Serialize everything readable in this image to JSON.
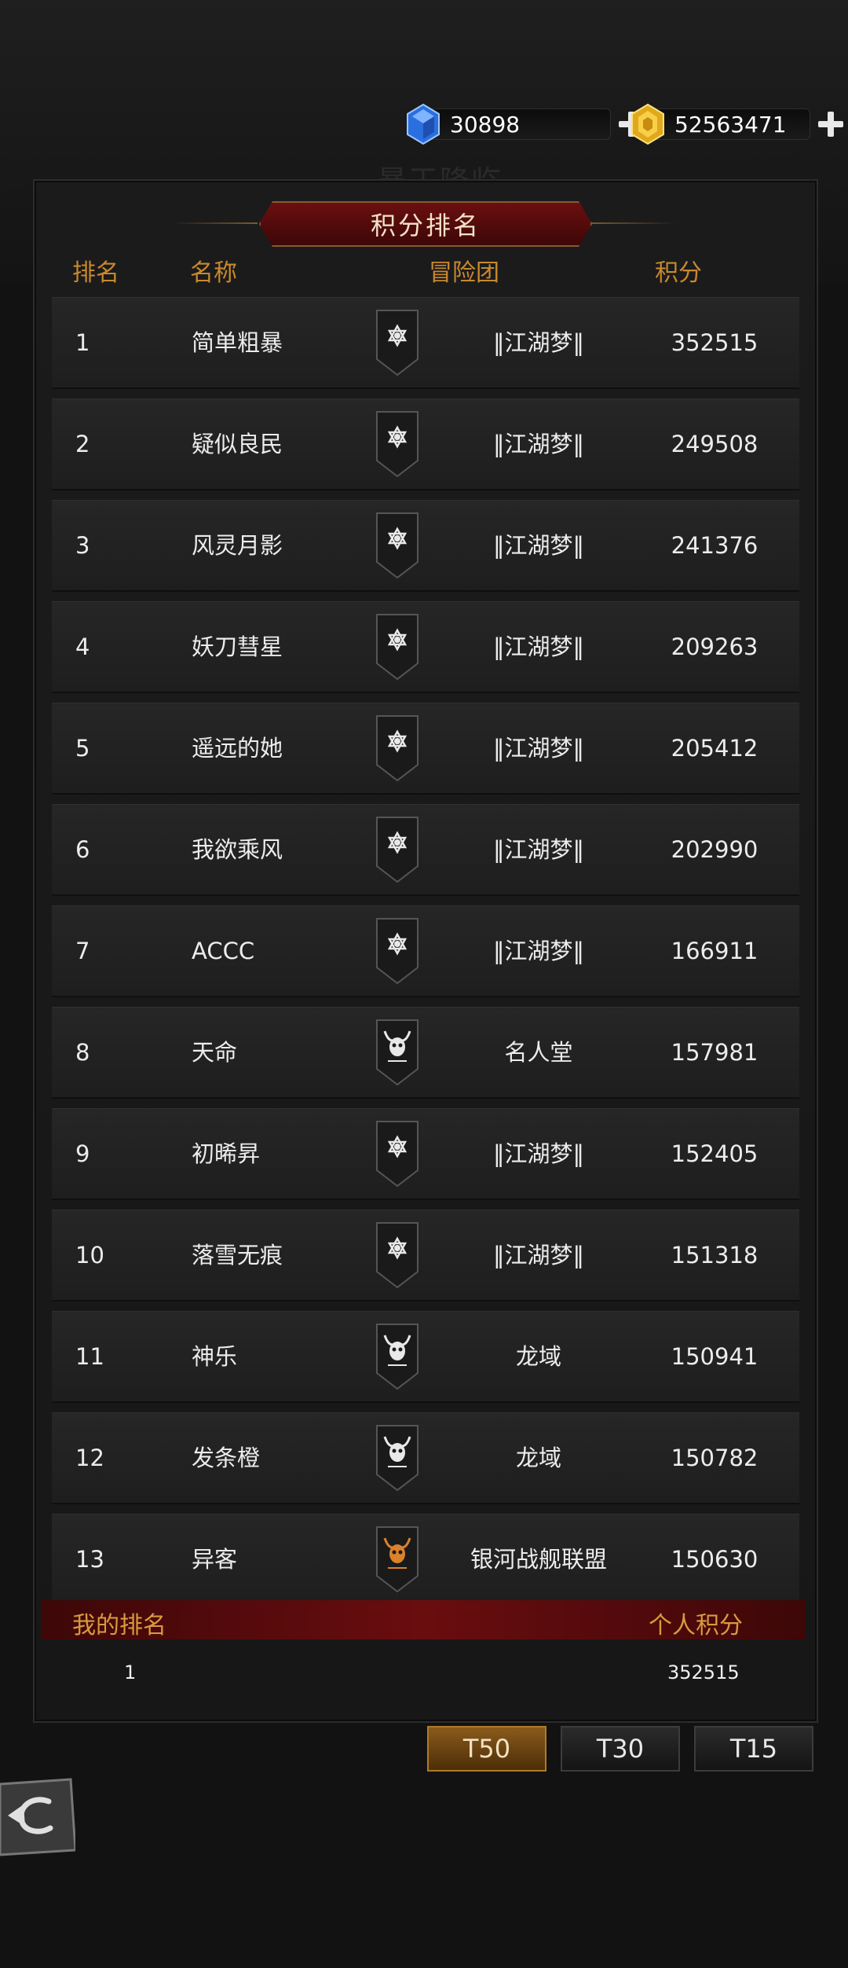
{
  "header": {
    "ghost_title": "暴王降临"
  },
  "currency": {
    "gems": "30898",
    "gold": "52563471"
  },
  "ranking": {
    "title": "积分排名",
    "col_rank": "排名",
    "col_name": "名称",
    "col_team": "冒险团",
    "col_score": "积分",
    "rows": [
      {
        "rank": "1",
        "name": "简单粗暴",
        "team": "‖江湖梦‖",
        "score": "352515",
        "emblem": "hexagram-icon"
      },
      {
        "rank": "2",
        "name": "疑似良民",
        "team": "‖江湖梦‖",
        "score": "249508",
        "emblem": "hexagram-icon"
      },
      {
        "rank": "3",
        "name": "风灵月影",
        "team": "‖江湖梦‖",
        "score": "241376",
        "emblem": "hexagram-icon"
      },
      {
        "rank": "4",
        "name": "妖刀彗星",
        "team": "‖江湖梦‖",
        "score": "209263",
        "emblem": "hexagram-icon"
      },
      {
        "rank": "5",
        "name": "遥远的她",
        "team": "‖江湖梦‖",
        "score": "205412",
        "emblem": "hexagram-icon"
      },
      {
        "rank": "6",
        "name": "我欲乘风",
        "team": "‖江湖梦‖",
        "score": "202990",
        "emblem": "hexagram-icon"
      },
      {
        "rank": "7",
        "name": "ACCC",
        "team": "‖江湖梦‖",
        "score": "166911",
        "emblem": "hexagram-icon"
      },
      {
        "rank": "8",
        "name": "天命",
        "team": "名人堂",
        "score": "157981",
        "emblem": "bull-skull-icon"
      },
      {
        "rank": "9",
        "name": "初晞昇",
        "team": "‖江湖梦‖",
        "score": "152405",
        "emblem": "hexagram-icon"
      },
      {
        "rank": "10",
        "name": "落雪无痕",
        "team": "‖江湖梦‖",
        "score": "151318",
        "emblem": "hexagram-icon"
      },
      {
        "rank": "11",
        "name": "神乐",
        "team": "龙域",
        "score": "150941",
        "emblem": "bull-skull-icon"
      },
      {
        "rank": "12",
        "name": "发条橙",
        "team": "龙域",
        "score": "150782",
        "emblem": "bull-skull-icon"
      },
      {
        "rank": "13",
        "name": "异客",
        "team": "银河战舰联盟",
        "score": "150630",
        "emblem": "bull-skull-orange-icon"
      }
    ]
  },
  "my_rank": {
    "label_rank": "我的排名",
    "label_score": "个人积分",
    "rank": "1",
    "score": "352515"
  },
  "tabs": [
    "T50",
    "T30",
    "T15"
  ],
  "active_tab": "T50",
  "colors": {
    "accent_gold": "#c8892d",
    "banner_red": "#6b0f10",
    "row_bg": "#262626"
  }
}
